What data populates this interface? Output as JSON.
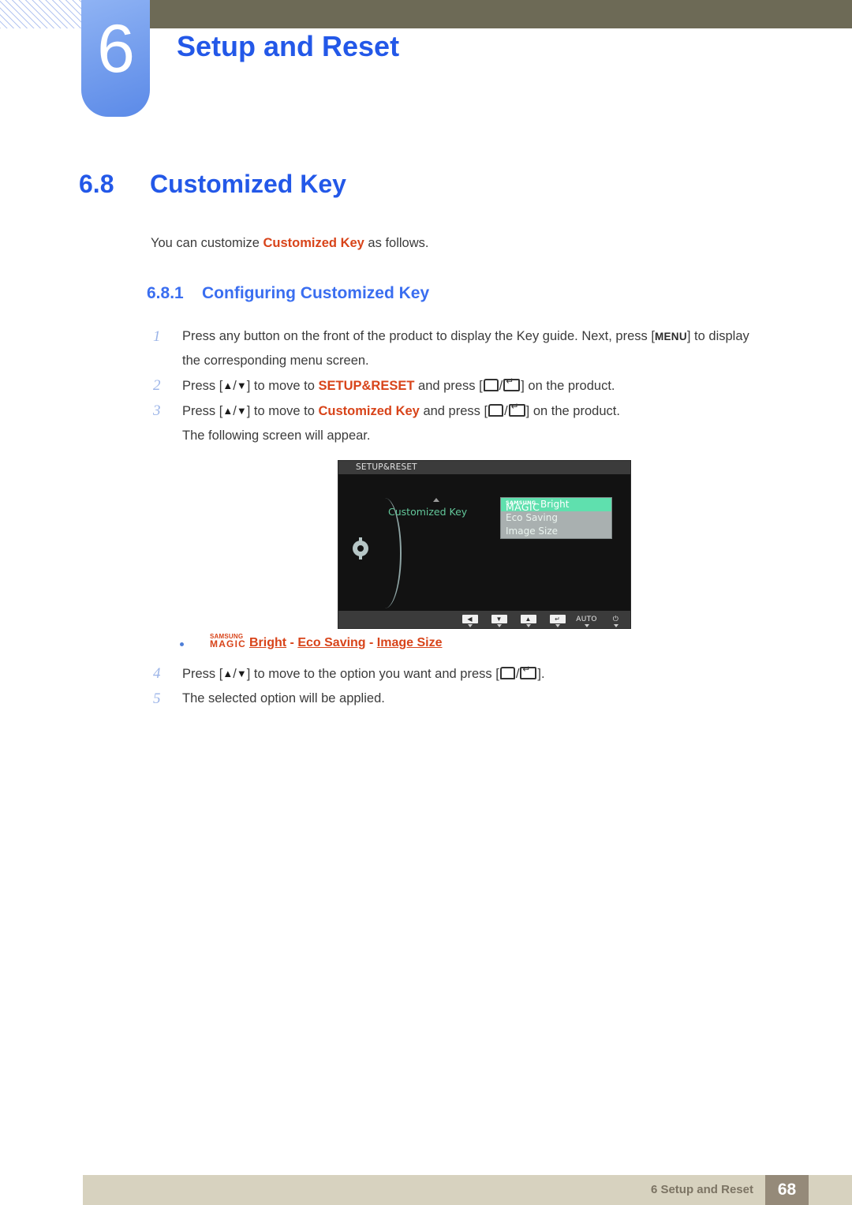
{
  "chapter": {
    "number": "6",
    "title": "Setup and Reset"
  },
  "section": {
    "number": "6.8",
    "title": "Customized Key"
  },
  "intro": {
    "before": "You can customize ",
    "highlight": "Customized Key",
    "after": " as follows."
  },
  "subsection": {
    "number": "6.8.1",
    "title": "Configuring Customized Key"
  },
  "steps": [
    {
      "number": "1",
      "parts": [
        {
          "t": "text",
          "v": "Press any button on the front of the product to display the Key guide. Next, press ["
        },
        {
          "t": "keycap",
          "v": "MENU"
        },
        {
          "t": "text",
          "v": "] to display"
        }
      ],
      "continuation": "the corresponding menu screen."
    },
    {
      "number": "2",
      "parts": [
        {
          "t": "text",
          "v": "Press ["
        },
        {
          "t": "tri-up",
          "v": "▲"
        },
        {
          "t": "text",
          "v": "/"
        },
        {
          "t": "tri-dn",
          "v": "▼"
        },
        {
          "t": "text",
          "v": "] to move to "
        },
        {
          "t": "hl",
          "v": "SETUP&RESET"
        },
        {
          "t": "text",
          "v": " and press ["
        },
        {
          "t": "gl-back",
          "v": ""
        },
        {
          "t": "text",
          "v": "/"
        },
        {
          "t": "gl-enter",
          "v": ""
        },
        {
          "t": "text",
          "v": "] on the product."
        }
      ],
      "continuation": ""
    },
    {
      "number": "3",
      "parts": [
        {
          "t": "text",
          "v": "Press ["
        },
        {
          "t": "tri-up",
          "v": "▲"
        },
        {
          "t": "text",
          "v": "/"
        },
        {
          "t": "tri-dn",
          "v": "▼"
        },
        {
          "t": "text",
          "v": "] to move to "
        },
        {
          "t": "hl",
          "v": "Customized Key"
        },
        {
          "t": "text",
          "v": " and press ["
        },
        {
          "t": "gl-back",
          "v": ""
        },
        {
          "t": "text",
          "v": "/"
        },
        {
          "t": "gl-enter",
          "v": ""
        },
        {
          "t": "text",
          "v": "] on the product."
        }
      ],
      "continuation": "The following screen will appear."
    }
  ],
  "steps_after": [
    {
      "number": "4",
      "parts": [
        {
          "t": "text",
          "v": "Press ["
        },
        {
          "t": "tri-up",
          "v": "▲"
        },
        {
          "t": "text",
          "v": "/"
        },
        {
          "t": "tri-dn",
          "v": "▼"
        },
        {
          "t": "text",
          "v": "] to move to the option you want and press ["
        },
        {
          "t": "gl-back",
          "v": ""
        },
        {
          "t": "text",
          "v": "/"
        },
        {
          "t": "gl-enter",
          "v": ""
        },
        {
          "t": "text",
          "v": "]."
        }
      ],
      "continuation": ""
    },
    {
      "number": "5",
      "parts": [
        {
          "t": "text",
          "v": "The selected option will be applied."
        }
      ],
      "continuation": ""
    }
  ],
  "osd": {
    "title": "SETUP&RESET",
    "menu_label": "Customized Key",
    "colon": ":",
    "options": [
      {
        "magic_top": "SAMSUNG",
        "magic_main": "MAGIC",
        "label": "Bright",
        "selected": true
      },
      {
        "magic_top": "",
        "magic_main": "",
        "label": "Eco Saving",
        "selected": false
      },
      {
        "magic_top": "",
        "magic_main": "",
        "label": "Image Size",
        "selected": false
      }
    ],
    "buttons": [
      {
        "icon": "left-arrow-icon",
        "glyph": "◀",
        "text": ""
      },
      {
        "icon": "down-arrow-icon",
        "glyph": "▼",
        "text": ""
      },
      {
        "icon": "up-arrow-icon",
        "glyph": "▲",
        "text": ""
      },
      {
        "icon": "enter-icon",
        "glyph": "↵",
        "text": ""
      },
      {
        "icon": "auto-label",
        "glyph": "",
        "text": "AUTO"
      },
      {
        "icon": "power-icon",
        "glyph": "⏻",
        "text": ""
      }
    ]
  },
  "bullet": {
    "magic_top": "SAMSUNG",
    "magic_main": "MAGIC",
    "links": [
      {
        "label": "Bright"
      },
      {
        "label": "Eco Saving"
      },
      {
        "label": "Image Size"
      }
    ],
    "separator": " - "
  },
  "footer": {
    "text": "6 Setup and Reset",
    "page": "68"
  },
  "colors": {
    "heading_blue": "#2358e8",
    "accent_orange": "#d8441a",
    "olive_bar": "#6d6a56",
    "tab_blue": "#77a0ee",
    "footer_bg": "#d7d2bf",
    "footer_page_bg": "#958a79",
    "osd_green": "#63c79a",
    "osd_highlight": "#5fe0ae"
  }
}
